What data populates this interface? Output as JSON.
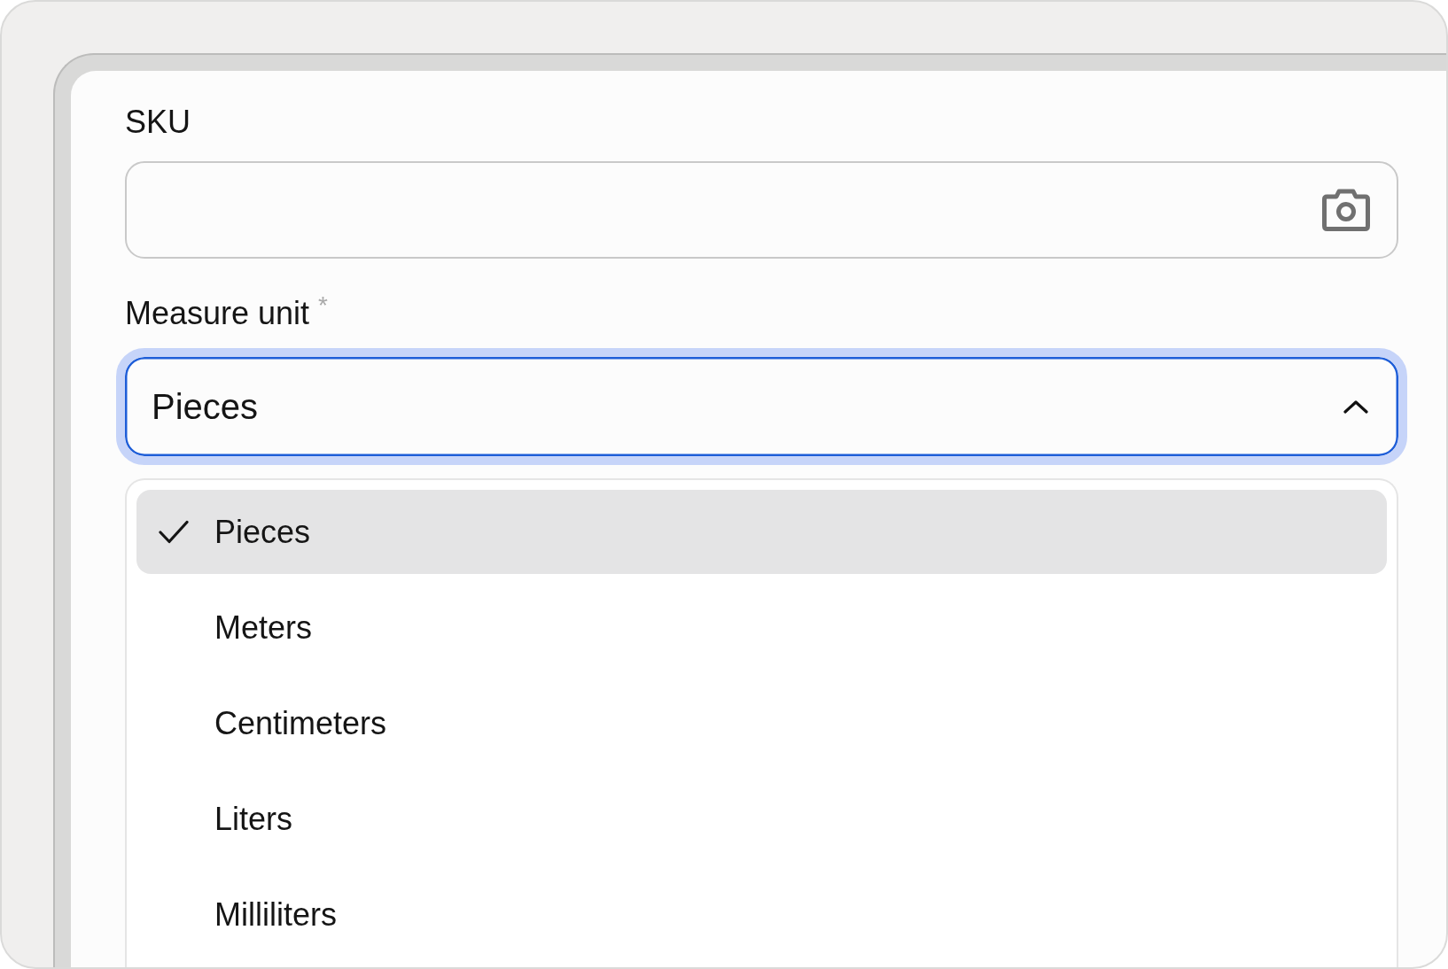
{
  "sku": {
    "label": "SKU"
  },
  "measure_unit": {
    "label": "Measure unit",
    "required_mark": "*",
    "value": "Pieces",
    "focused": true,
    "expanded": true,
    "options": [
      {
        "label": "Pieces",
        "selected": true
      },
      {
        "label": "Meters",
        "selected": false
      },
      {
        "label": "Centimeters",
        "selected": false
      },
      {
        "label": "Liters",
        "selected": false
      },
      {
        "label": "Milliliters",
        "selected": false
      }
    ]
  }
}
